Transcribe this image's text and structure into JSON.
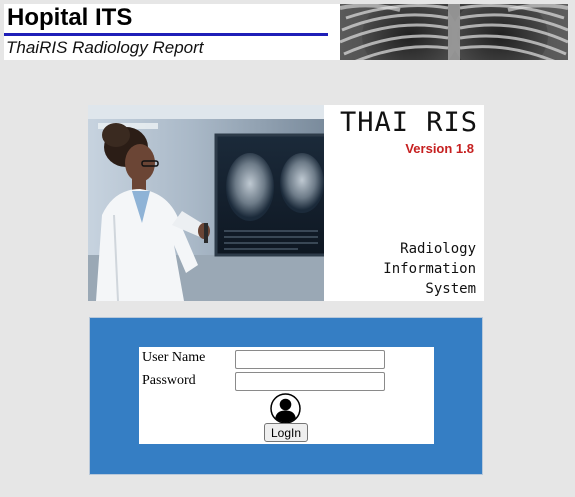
{
  "header": {
    "title": "Hopital ITS",
    "subtitle": "ThaiRIS Radiology Report",
    "rule_color": "#1f1fb8"
  },
  "hero": {
    "brand": "THAI RIS",
    "version": "Version 1.8",
    "version_color": "#c62020",
    "description_lines": [
      "Radiology",
      "Information",
      "System"
    ]
  },
  "login": {
    "panel_color": "#357ec4",
    "username_label": "User Name",
    "username_value": "",
    "password_label": "Password",
    "password_value": "",
    "avatar_icon": "user-avatar-icon",
    "button_label": "LogIn"
  }
}
